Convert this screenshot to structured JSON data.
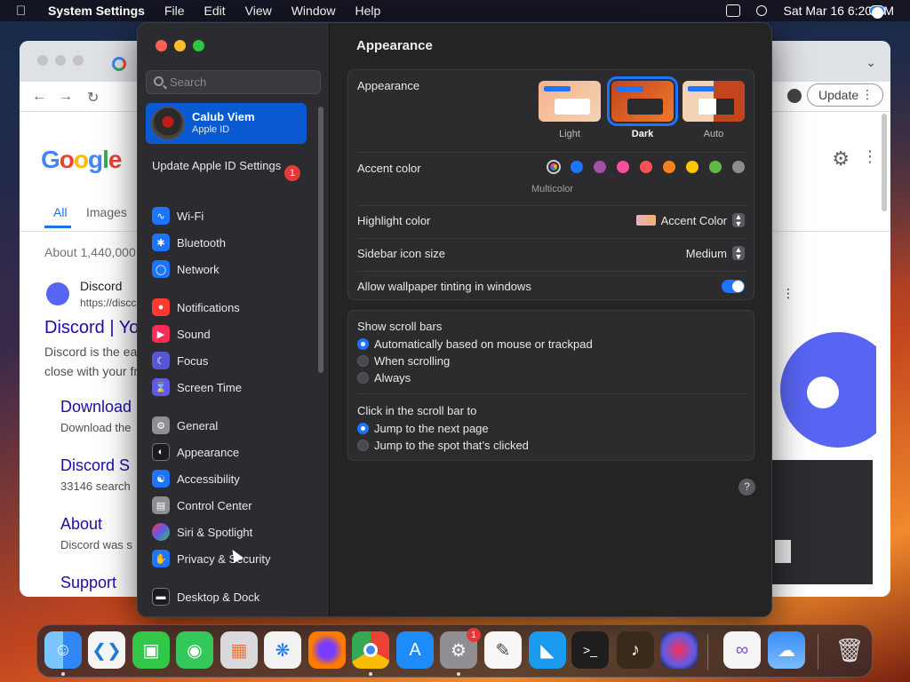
{
  "menubar": {
    "app_name": "System Settings",
    "menus": [
      "File",
      "Edit",
      "View",
      "Window",
      "Help"
    ],
    "datetime": "Sat Mar 16  6:20 PM"
  },
  "chrome": {
    "update_label": "Update",
    "google_tabs": [
      "All",
      "Images"
    ],
    "about_text": "About 1,440,000",
    "result_site": "Discord",
    "result_url": "https://discc",
    "result_title": "Discord | Yo",
    "snippet_line1": "Discord is the ea",
    "snippet_line1_bold": "Discord",
    "snippet_line2": "close with your fr",
    "sublinks": [
      {
        "title": "Download",
        "desc": "Download the"
      },
      {
        "title": "Discord S",
        "desc": "33146 search"
      },
      {
        "title": "About",
        "desc": "Discord was s"
      },
      {
        "title": "Support",
        "desc": ""
      }
    ]
  },
  "settings": {
    "search_placeholder": "Search",
    "account": {
      "name": "Calub Viem",
      "subtitle": "Apple ID"
    },
    "update_apple_id": "Update Apple ID Settings",
    "update_badge": "1",
    "sidebar_items": [
      {
        "label": "Wi-Fi",
        "icon": "wifi-icon",
        "color": "#1d75ff"
      },
      {
        "label": "Bluetooth",
        "icon": "bluetooth-icon",
        "color": "#1d75ff"
      },
      {
        "label": "Network",
        "icon": "globe-icon",
        "color": "#1d75ff"
      },
      {
        "label": "Notifications",
        "icon": "bell-icon",
        "color": "#ff3b30"
      },
      {
        "label": "Sound",
        "icon": "speaker-icon",
        "color": "#ff2d55"
      },
      {
        "label": "Focus",
        "icon": "moon-icon",
        "color": "#5856d6"
      },
      {
        "label": "Screen Time",
        "icon": "hourglass-icon",
        "color": "#5e5ce6"
      },
      {
        "label": "General",
        "icon": "gear-icon",
        "color": "#8e8e93"
      },
      {
        "label": "Appearance",
        "icon": "appearance-icon",
        "color": "#1c1c1e"
      },
      {
        "label": "Accessibility",
        "icon": "accessibility-icon",
        "color": "#1d75ff"
      },
      {
        "label": "Control Center",
        "icon": "control-center-icon",
        "color": "#8e8e93"
      },
      {
        "label": "Siri & Spotlight",
        "icon": "siri-icon",
        "color": "#af52de"
      },
      {
        "label": "Privacy & Security",
        "icon": "hand-icon",
        "color": "#1d75ff"
      },
      {
        "label": "Desktop & Dock",
        "icon": "dock-icon",
        "color": "#1c1c1e"
      }
    ],
    "page_title": "Appearance",
    "appearance": {
      "label": "Appearance",
      "options": [
        "Light",
        "Dark",
        "Auto"
      ],
      "selected": "Dark"
    },
    "accent": {
      "label": "Accent color",
      "colors": [
        "multicolor",
        "#1d75ff",
        "#a550a7",
        "#f74f9e",
        "#ff5257",
        "#f7821b",
        "#ffc600",
        "#62ba46",
        "#8c8c8c"
      ],
      "caption": "Multicolor"
    },
    "highlight": {
      "label": "Highlight color",
      "value": "Accent Color"
    },
    "sidebar_icon_size": {
      "label": "Sidebar icon size",
      "value": "Medium"
    },
    "wallpaper_tinting": {
      "label": "Allow wallpaper tinting in windows",
      "on": true
    },
    "scroll_bars": {
      "label": "Show scroll bars",
      "options": [
        "Automatically based on mouse or trackpad",
        "When scrolling",
        "Always"
      ],
      "selected": 0
    },
    "click_scroll": {
      "label": "Click in the scroll bar to",
      "options": [
        "Jump to the next page",
        "Jump to the spot that’s clicked"
      ],
      "selected": 0
    },
    "help_label": "?"
  },
  "dock": {
    "apps": [
      {
        "name": "Finder",
        "icon": "finder-icon"
      },
      {
        "name": "Visual Studio Code",
        "icon": "vscode-icon"
      },
      {
        "name": "FaceTime",
        "icon": "facetime-icon"
      },
      {
        "name": "Messages",
        "icon": "messages-icon"
      },
      {
        "name": "Launchpad",
        "icon": "launchpad-icon"
      },
      {
        "name": "Safari",
        "icon": "safari-icon"
      },
      {
        "name": "Firefox",
        "icon": "firefox-icon"
      },
      {
        "name": "Google Chrome",
        "icon": "chrome-icon"
      },
      {
        "name": "App Store",
        "icon": "app-store-icon"
      },
      {
        "name": "System Settings",
        "icon": "system-settings-icon"
      },
      {
        "name": "TextEdit",
        "icon": "textedit-icon"
      },
      {
        "name": "Keynote",
        "icon": "keynote-icon"
      },
      {
        "name": "Terminal",
        "icon": "terminal-icon"
      },
      {
        "name": "GarageBand",
        "icon": "garageband-icon"
      },
      {
        "name": "Siri",
        "icon": "siri-icon"
      },
      {
        "name": "Visual Studio",
        "icon": "visual-studio-icon"
      },
      {
        "name": "Weather",
        "icon": "weather-icon"
      },
      {
        "name": "Trash",
        "icon": "trash-icon"
      }
    ],
    "settings_badge": "1"
  }
}
